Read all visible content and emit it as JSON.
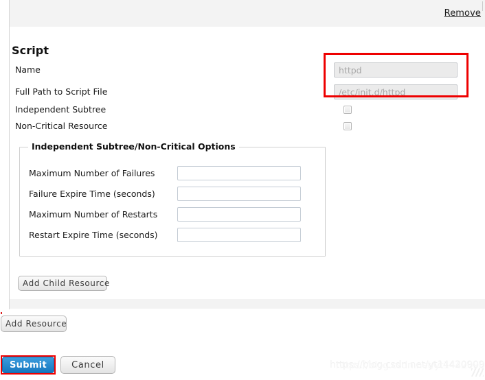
{
  "header": {
    "remove_label": "Remove"
  },
  "section": {
    "title": "Script",
    "rows": [
      {
        "label": "Name",
        "type": "text",
        "value": "",
        "placeholder": "httpd"
      },
      {
        "label": "Full Path to Script File",
        "type": "text",
        "value": "",
        "placeholder": "/etc/init.d/httpd"
      },
      {
        "label": "Independent Subtree",
        "type": "checkbox",
        "checked": false
      },
      {
        "label": "Non-Critical Resource",
        "type": "checkbox",
        "checked": false
      }
    ]
  },
  "fieldset": {
    "legend": "Independent Subtree/Non-Critical Options",
    "rows": [
      {
        "label": "Maximum Number of Failures",
        "value": "",
        "placeholder": ""
      },
      {
        "label": "Failure Expire Time (seconds)",
        "value": "",
        "placeholder": ""
      },
      {
        "label": "Maximum Number of Restarts",
        "value": "",
        "placeholder": ""
      },
      {
        "label": "Restart Expire Time (seconds)",
        "value": "",
        "placeholder": ""
      }
    ]
  },
  "buttons": {
    "add_child_resource": "Add Child Resource",
    "add_resource": "Add Resource",
    "submit": "Submit",
    "cancel": "Cancel"
  },
  "watermark": {
    "text": "https://blog.csdn.net/yt14420909"
  },
  "colors": {
    "highlight": "#ee0000",
    "submit_blue": "#1577c0",
    "header_grey": "#f3f3f3",
    "input_grey": "#ebebeb"
  }
}
